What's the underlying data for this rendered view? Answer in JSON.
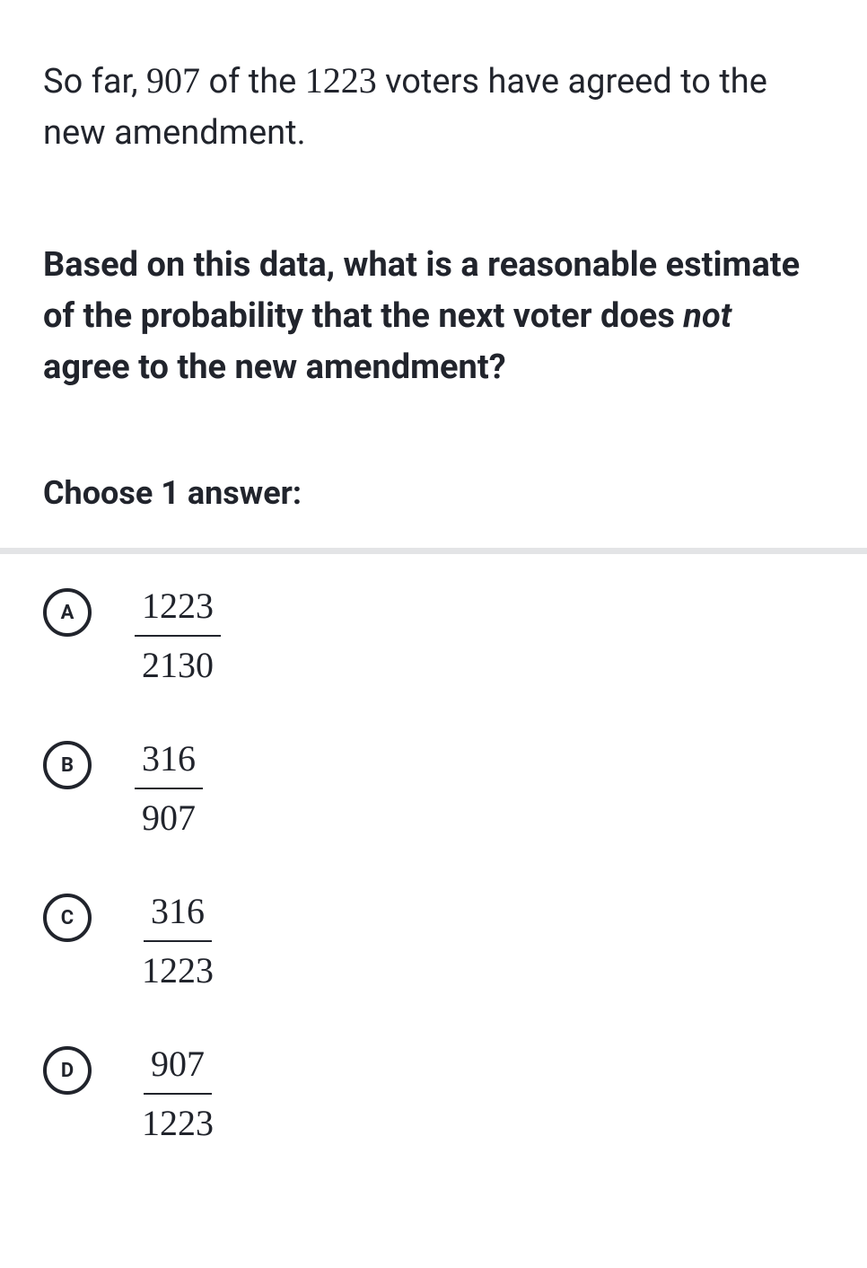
{
  "problem": {
    "prefix": "So far, ",
    "num1": "907",
    "mid1": " of the ",
    "num2": "1223",
    "suffix": " voters have agreed to the new amendment."
  },
  "question": {
    "part1": "Based on this data, what is a reasonable estimate of the probability that the next voter does ",
    "emphasis": "not",
    "part2": " agree to the new amendment?"
  },
  "choose_label": "Choose 1 answer:",
  "options": [
    {
      "letter": "A",
      "numerator": "1223",
      "denominator": "2130"
    },
    {
      "letter": "B",
      "numerator": "316",
      "denominator": "907"
    },
    {
      "letter": "C",
      "numerator": "316",
      "denominator": "1223"
    },
    {
      "letter": "D",
      "numerator": "907",
      "denominator": "1223"
    }
  ]
}
